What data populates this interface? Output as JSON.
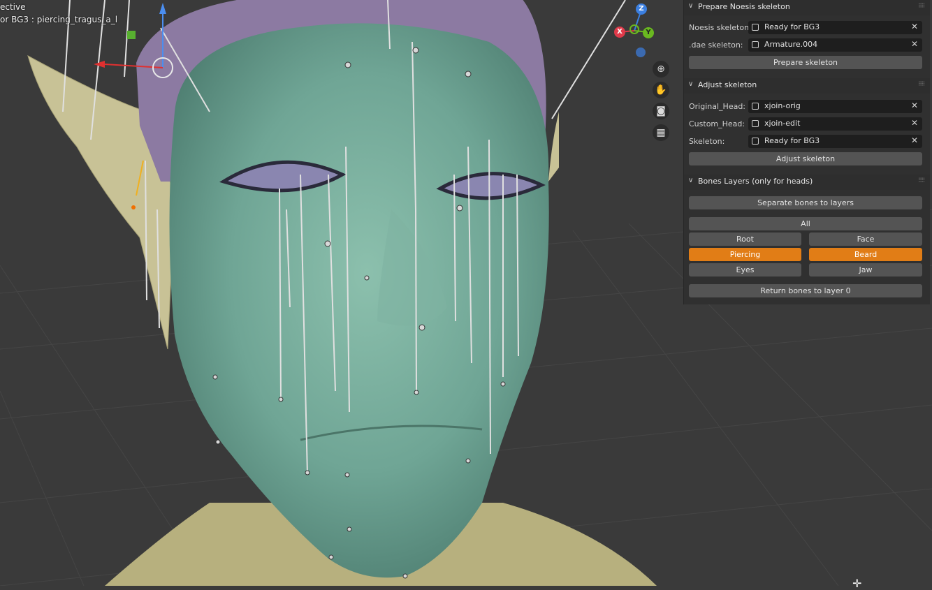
{
  "viewport": {
    "mode_text": "ective",
    "object_text": "or BG3 : piercing_tragus_a_l",
    "gizmo": {
      "z": "Z",
      "x": "X",
      "y": "Y"
    },
    "nav_icons": [
      "zoom-icon",
      "hand-pan-icon",
      "camera-icon",
      "grid-perspective-icon"
    ],
    "colors": {
      "skin": "#6fa595",
      "ear": "#c8c296",
      "cap": "#8c7aa2",
      "bg": "#3a3a3a"
    }
  },
  "panel": {
    "prepare": {
      "title": "Prepare Noesis skeleton",
      "noesis_label": "Noesis skeleton:",
      "noesis_value": "Ready for BG3",
      "dae_label": ".dae skeleton:",
      "dae_value": "Armature.004",
      "button": "Prepare skeleton"
    },
    "adjust": {
      "title": "Adjust skeleton",
      "orig_label": "Original_Head:",
      "orig_value": "xjoin-orig",
      "custom_label": "Custom_Head:",
      "custom_value": "xjoin-edit",
      "skeleton_label": "Skeleton:",
      "skeleton_value": "Ready for BG3",
      "button": "Adjust skeleton"
    },
    "layers": {
      "title": "Bones Layers (only for heads)",
      "separate": "Separate bones to layers",
      "all": "All",
      "root": "Root",
      "face": "Face",
      "piercing": "Piercing",
      "beard": "Beard",
      "eyes": "Eyes",
      "jaw": "Jaw",
      "return": "Return bones to layer 0"
    },
    "accent_color": "#e17d16"
  }
}
